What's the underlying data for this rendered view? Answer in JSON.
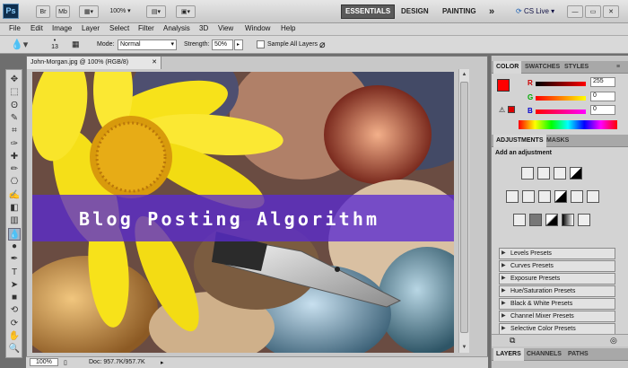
{
  "appbar": {
    "logo": "Ps",
    "zoom": "100%",
    "workspaces": [
      "ESSENTIALS",
      "DESIGN",
      "PAINTING"
    ],
    "more": "»",
    "cslive": "CS Live ▾"
  },
  "menu": [
    "File",
    "Edit",
    "Image",
    "Layer",
    "Select",
    "Filter",
    "Analysis",
    "3D",
    "View",
    "Window",
    "Help"
  ],
  "options": {
    "brush_size": "13",
    "mode_label": "Mode:",
    "mode_value": "Normal",
    "strength_label": "Strength:",
    "strength_value": "50%",
    "sample_label": "Sample All Layers"
  },
  "document": {
    "tab": "John-Morgan.jpg @ 100% (RGB/8)",
    "banner_text": "Blog Posting Algorithm"
  },
  "status": {
    "zoom": "100%",
    "doc": "Doc: 957.7K/957.7K"
  },
  "color_panel": {
    "tabs": [
      "COLOR",
      "SWATCHES",
      "STYLES"
    ],
    "r_label": "R",
    "r_value": "255",
    "g_label": "G",
    "g_value": "0",
    "b_label": "B",
    "b_value": "0",
    "foreground": "#ff0000"
  },
  "adjustments": {
    "tabs": [
      "ADJUSTMENTS",
      "MASKS"
    ],
    "heading": "Add an adjustment",
    "presets": [
      "Levels Presets",
      "Curves Presets",
      "Exposure Presets",
      "Hue/Saturation Presets",
      "Black & White Presets",
      "Channel Mixer Presets",
      "Selective Color Presets"
    ]
  },
  "layers": {
    "tabs": [
      "LAYERS",
      "CHANNELS",
      "PATHS"
    ]
  },
  "tools": [
    "move-tool",
    "marquee-tool",
    "lasso-tool",
    "quick-select-tool",
    "crop-tool",
    "eyedropper-tool",
    "healing-tool",
    "brush-tool",
    "clone-stamp-tool",
    "history-brush-tool",
    "eraser-tool",
    "gradient-tool",
    "blur-tool",
    "dodge-tool",
    "pen-tool",
    "type-tool",
    "path-select-tool",
    "shape-tool",
    "3d-rotate-tool",
    "3d-orbit-tool",
    "hand-tool",
    "zoom-tool"
  ]
}
